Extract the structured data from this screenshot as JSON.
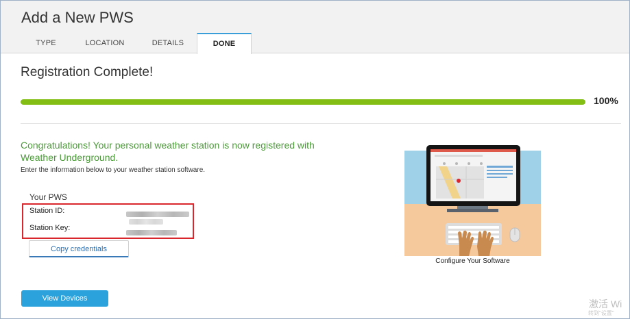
{
  "header": {
    "title": "Add a New PWS",
    "tabs": [
      {
        "label": "TYPE"
      },
      {
        "label": "LOCATION"
      },
      {
        "label": "DETAILS"
      },
      {
        "label": "DONE",
        "active": true
      }
    ]
  },
  "registration": {
    "title": "Registration Complete!",
    "progress_value": 1.0,
    "progress_label": "100%",
    "progress_color": "#82be14"
  },
  "message": {
    "congrats": "Congratulations! Your personal weather station is now registered with Weather Underground.",
    "instructions": "Enter the information below to your weather station software."
  },
  "credentials": {
    "heading": "Your PWS",
    "station_id_label": "Station ID:",
    "station_key_label": "Station Key:",
    "copy_button": "Copy credentials",
    "highlight_color": "#d9262c"
  },
  "illustration": {
    "icon": "computer-setup-illustration",
    "caption": "Configure Your Software"
  },
  "actions": {
    "view_devices": "View Devices",
    "button_color": "#2ba2dc"
  },
  "watermark": {
    "line1": "激活 Wi",
    "line2": "转到\"设置\""
  }
}
